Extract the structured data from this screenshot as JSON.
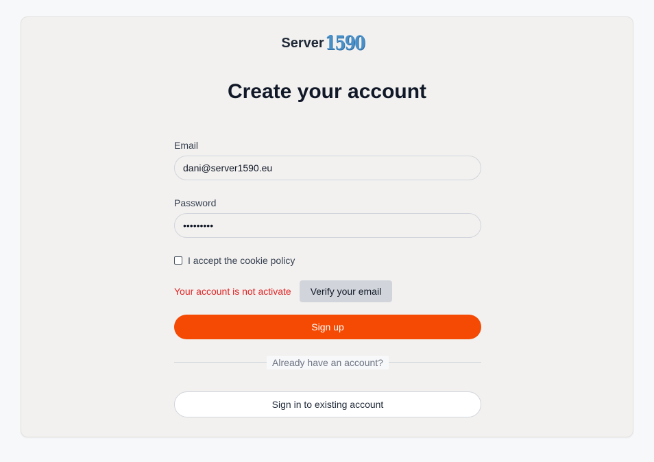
{
  "logo": {
    "text": "Server",
    "number": "1590"
  },
  "page": {
    "title": "Create your account"
  },
  "form": {
    "email_label": "Email",
    "email_value": "dani@server1590.eu",
    "password_label": "Password",
    "password_value": "•••••••••",
    "cookie_label": "I accept the cookie policy",
    "cookie_checked": false
  },
  "status": {
    "error_text": "Your account is not activate",
    "verify_label": "Verify your email"
  },
  "actions": {
    "signup_label": "Sign up",
    "divider_text": "Already have an account?",
    "signin_label": "Sign in to existing account"
  },
  "colors": {
    "primary": "#f44a03",
    "error": "#e02424",
    "logo_number": "#4a90c8"
  }
}
